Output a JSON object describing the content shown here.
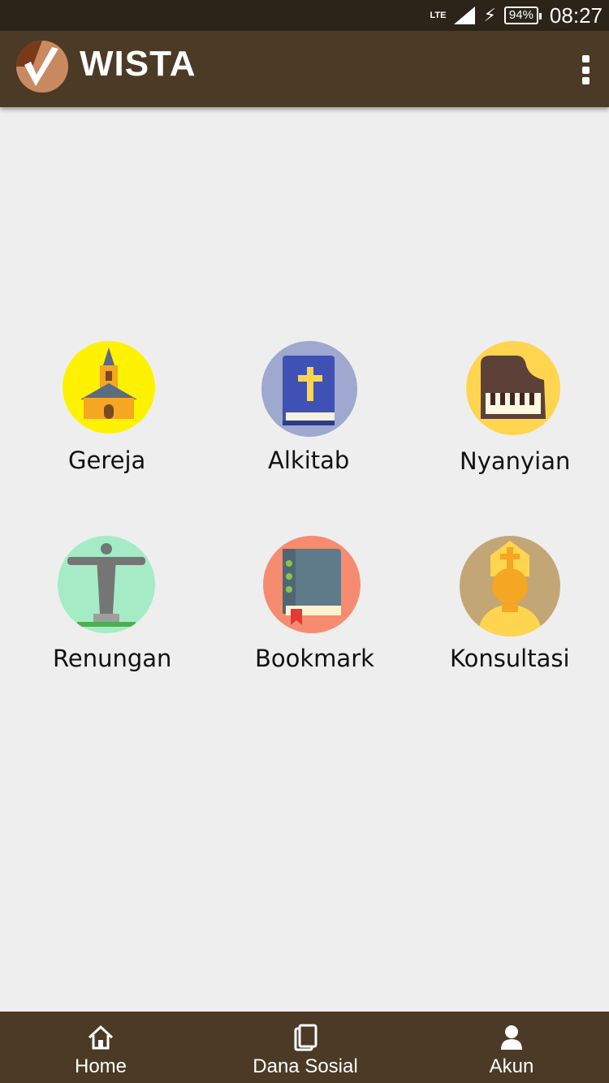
{
  "status_bar": {
    "network": "LTE",
    "battery": "94%",
    "time": "08:27"
  },
  "app_bar": {
    "title": "WISTA",
    "logo_icon": "wista-logo-icon",
    "menu_icon": "overflow-menu-icon"
  },
  "menu": {
    "items": [
      {
        "label": "Gereja",
        "icon": "church-icon",
        "color": "#fff200"
      },
      {
        "label": "Alkitab",
        "icon": "bible-icon",
        "color": "#9fa8cf"
      },
      {
        "label": "Nyanyian",
        "icon": "piano-icon",
        "color": "#ffd54f"
      },
      {
        "label": "Renungan",
        "icon": "christ-statue-icon",
        "color": "#a5ecc6"
      },
      {
        "label": "Bookmark",
        "icon": "book-bookmark-icon",
        "color": "#f68c6f"
      },
      {
        "label": "Konsultasi",
        "icon": "priest-icon",
        "color": "#c2a676"
      }
    ]
  },
  "bottom_nav": {
    "items": [
      {
        "label": "Home",
        "icon": "home-icon"
      },
      {
        "label": "Dana Sosial",
        "icon": "pages-icon"
      },
      {
        "label": "Akun",
        "icon": "person-icon"
      }
    ]
  },
  "colors": {
    "app_bar": "#4b3a25",
    "status_bar": "#2c2418",
    "background": "#eeeeee"
  }
}
